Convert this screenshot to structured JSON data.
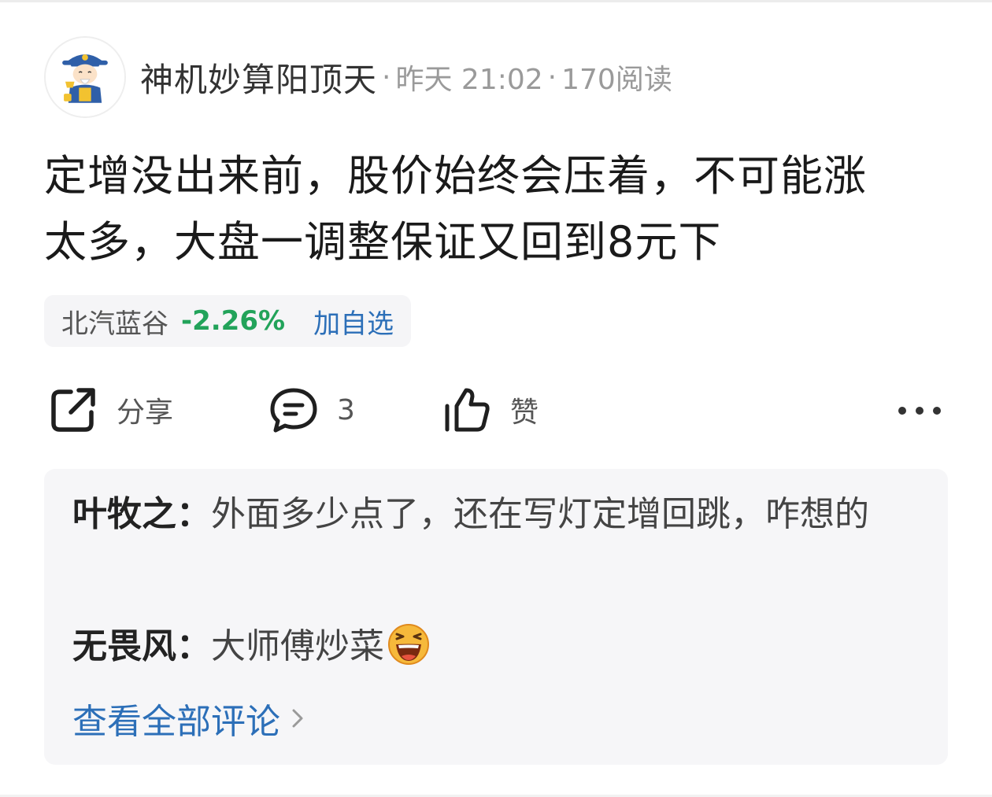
{
  "post": {
    "author": "神机妙算阳顶天",
    "separator": "·",
    "time": "昨天 21:02",
    "views": "170阅读",
    "text_line1": "定增没出来前，股价始终会压着，不可能涨",
    "text_line2": "太多，大盘一调整保证又回到8元下"
  },
  "stock": {
    "name": "北汽蓝谷",
    "change": "-2.26%",
    "add_label": "加自选",
    "change_color": "#22a35a"
  },
  "actions": {
    "share_label": "分享",
    "comment_count": "3",
    "like_label": "赞",
    "share_icon": "share-icon",
    "comment_icon": "comment-bubble-icon",
    "like_icon": "thumbs-up-icon",
    "more_icon": "more-dots-icon"
  },
  "comments": [
    {
      "author": "叶牧之",
      "colon": "：",
      "text": "外面多少点了，还在写灯定增回跳，咋想的"
    },
    {
      "author": "无畏风",
      "colon": "：",
      "text": "大师傅炒菜",
      "emoji": "laughing-face-icon"
    }
  ],
  "view_all": {
    "label": "查看全部评论"
  },
  "colors": {
    "accent_blue": "#2c6fb8",
    "down_green": "#22a35a",
    "comment_bg": "#f6f6f8"
  }
}
